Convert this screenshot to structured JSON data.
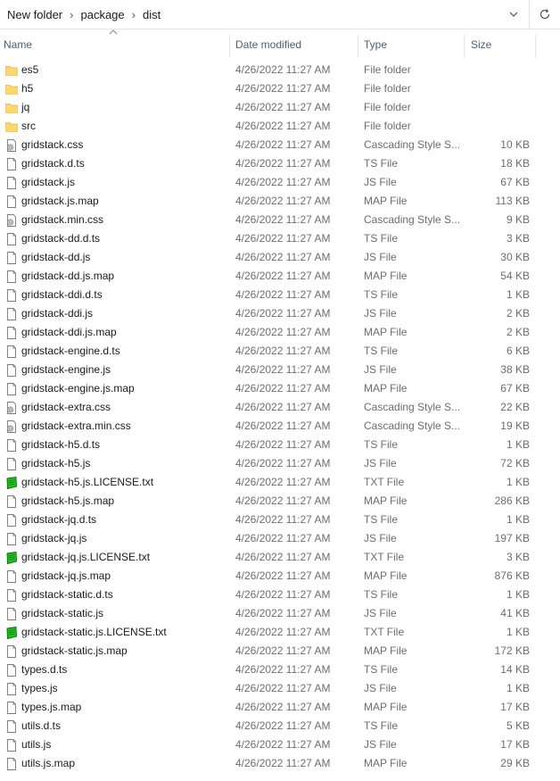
{
  "breadcrumb": [
    "New folder",
    "package",
    "dist"
  ],
  "columns": {
    "name": "Name",
    "date": "Date modified",
    "type": "Type",
    "size": "Size"
  },
  "files": [
    {
      "name": "es5",
      "date": "4/26/2022 11:27 AM",
      "type": "File folder",
      "size": "",
      "icon": "folder-icon"
    },
    {
      "name": "h5",
      "date": "4/26/2022 11:27 AM",
      "type": "File folder",
      "size": "",
      "icon": "folder-icon"
    },
    {
      "name": "jq",
      "date": "4/26/2022 11:27 AM",
      "type": "File folder",
      "size": "",
      "icon": "folder-icon"
    },
    {
      "name": "src",
      "date": "4/26/2022 11:27 AM",
      "type": "File folder",
      "size": "",
      "icon": "folder-icon"
    },
    {
      "name": "gridstack.css",
      "date": "4/26/2022 11:27 AM",
      "type": "Cascading Style S...",
      "size": "10 KB",
      "icon": "css-file-icon"
    },
    {
      "name": "gridstack.d.ts",
      "date": "4/26/2022 11:27 AM",
      "type": "TS File",
      "size": "18 KB",
      "icon": "file-icon"
    },
    {
      "name": "gridstack.js",
      "date": "4/26/2022 11:27 AM",
      "type": "JS File",
      "size": "67 KB",
      "icon": "file-icon"
    },
    {
      "name": "gridstack.js.map",
      "date": "4/26/2022 11:27 AM",
      "type": "MAP File",
      "size": "113 KB",
      "icon": "file-icon"
    },
    {
      "name": "gridstack.min.css",
      "date": "4/26/2022 11:27 AM",
      "type": "Cascading Style S...",
      "size": "9 KB",
      "icon": "css-file-icon"
    },
    {
      "name": "gridstack-dd.d.ts",
      "date": "4/26/2022 11:27 AM",
      "type": "TS File",
      "size": "3 KB",
      "icon": "file-icon"
    },
    {
      "name": "gridstack-dd.js",
      "date": "4/26/2022 11:27 AM",
      "type": "JS File",
      "size": "30 KB",
      "icon": "file-icon"
    },
    {
      "name": "gridstack-dd.js.map",
      "date": "4/26/2022 11:27 AM",
      "type": "MAP File",
      "size": "54 KB",
      "icon": "file-icon"
    },
    {
      "name": "gridstack-ddi.d.ts",
      "date": "4/26/2022 11:27 AM",
      "type": "TS File",
      "size": "1 KB",
      "icon": "file-icon"
    },
    {
      "name": "gridstack-ddi.js",
      "date": "4/26/2022 11:27 AM",
      "type": "JS File",
      "size": "2 KB",
      "icon": "file-icon"
    },
    {
      "name": "gridstack-ddi.js.map",
      "date": "4/26/2022 11:27 AM",
      "type": "MAP File",
      "size": "2 KB",
      "icon": "file-icon"
    },
    {
      "name": "gridstack-engine.d.ts",
      "date": "4/26/2022 11:27 AM",
      "type": "TS File",
      "size": "6 KB",
      "icon": "file-icon"
    },
    {
      "name": "gridstack-engine.js",
      "date": "4/26/2022 11:27 AM",
      "type": "JS File",
      "size": "38 KB",
      "icon": "file-icon"
    },
    {
      "name": "gridstack-engine.js.map",
      "date": "4/26/2022 11:27 AM",
      "type": "MAP File",
      "size": "67 KB",
      "icon": "file-icon"
    },
    {
      "name": "gridstack-extra.css",
      "date": "4/26/2022 11:27 AM",
      "type": "Cascading Style S...",
      "size": "22 KB",
      "icon": "css-file-icon"
    },
    {
      "name": "gridstack-extra.min.css",
      "date": "4/26/2022 11:27 AM",
      "type": "Cascading Style S...",
      "size": "19 KB",
      "icon": "css-file-icon"
    },
    {
      "name": "gridstack-h5.d.ts",
      "date": "4/26/2022 11:27 AM",
      "type": "TS File",
      "size": "1 KB",
      "icon": "file-icon"
    },
    {
      "name": "gridstack-h5.js",
      "date": "4/26/2022 11:27 AM",
      "type": "JS File",
      "size": "72 KB",
      "icon": "file-icon"
    },
    {
      "name": "gridstack-h5.js.LICENSE.txt",
      "date": "4/26/2022 11:27 AM",
      "type": "TXT File",
      "size": "1 KB",
      "icon": "txt-file-icon"
    },
    {
      "name": "gridstack-h5.js.map",
      "date": "4/26/2022 11:27 AM",
      "type": "MAP File",
      "size": "286 KB",
      "icon": "file-icon"
    },
    {
      "name": "gridstack-jq.d.ts",
      "date": "4/26/2022 11:27 AM",
      "type": "TS File",
      "size": "1 KB",
      "icon": "file-icon"
    },
    {
      "name": "gridstack-jq.js",
      "date": "4/26/2022 11:27 AM",
      "type": "JS File",
      "size": "197 KB",
      "icon": "file-icon"
    },
    {
      "name": "gridstack-jq.js.LICENSE.txt",
      "date": "4/26/2022 11:27 AM",
      "type": "TXT File",
      "size": "3 KB",
      "icon": "txt-file-icon"
    },
    {
      "name": "gridstack-jq.js.map",
      "date": "4/26/2022 11:27 AM",
      "type": "MAP File",
      "size": "876 KB",
      "icon": "file-icon"
    },
    {
      "name": "gridstack-static.d.ts",
      "date": "4/26/2022 11:27 AM",
      "type": "TS File",
      "size": "1 KB",
      "icon": "file-icon"
    },
    {
      "name": "gridstack-static.js",
      "date": "4/26/2022 11:27 AM",
      "type": "JS File",
      "size": "41 KB",
      "icon": "file-icon"
    },
    {
      "name": "gridstack-static.js.LICENSE.txt",
      "date": "4/26/2022 11:27 AM",
      "type": "TXT File",
      "size": "1 KB",
      "icon": "txt-file-icon"
    },
    {
      "name": "gridstack-static.js.map",
      "date": "4/26/2022 11:27 AM",
      "type": "MAP File",
      "size": "172 KB",
      "icon": "file-icon"
    },
    {
      "name": "types.d.ts",
      "date": "4/26/2022 11:27 AM",
      "type": "TS File",
      "size": "14 KB",
      "icon": "file-icon"
    },
    {
      "name": "types.js",
      "date": "4/26/2022 11:27 AM",
      "type": "JS File",
      "size": "1 KB",
      "icon": "file-icon"
    },
    {
      "name": "types.js.map",
      "date": "4/26/2022 11:27 AM",
      "type": "MAP File",
      "size": "17 KB",
      "icon": "file-icon"
    },
    {
      "name": "utils.d.ts",
      "date": "4/26/2022 11:27 AM",
      "type": "TS File",
      "size": "5 KB",
      "icon": "file-icon"
    },
    {
      "name": "utils.js",
      "date": "4/26/2022 11:27 AM",
      "type": "JS File",
      "size": "17 KB",
      "icon": "file-icon"
    },
    {
      "name": "utils.js.map",
      "date": "4/26/2022 11:27 AM",
      "type": "MAP File",
      "size": "29 KB",
      "icon": "file-icon"
    }
  ],
  "colors": {
    "folder": "#f8d775",
    "txt_green": "#1fbf1f",
    "header_text": "#4c607a"
  }
}
